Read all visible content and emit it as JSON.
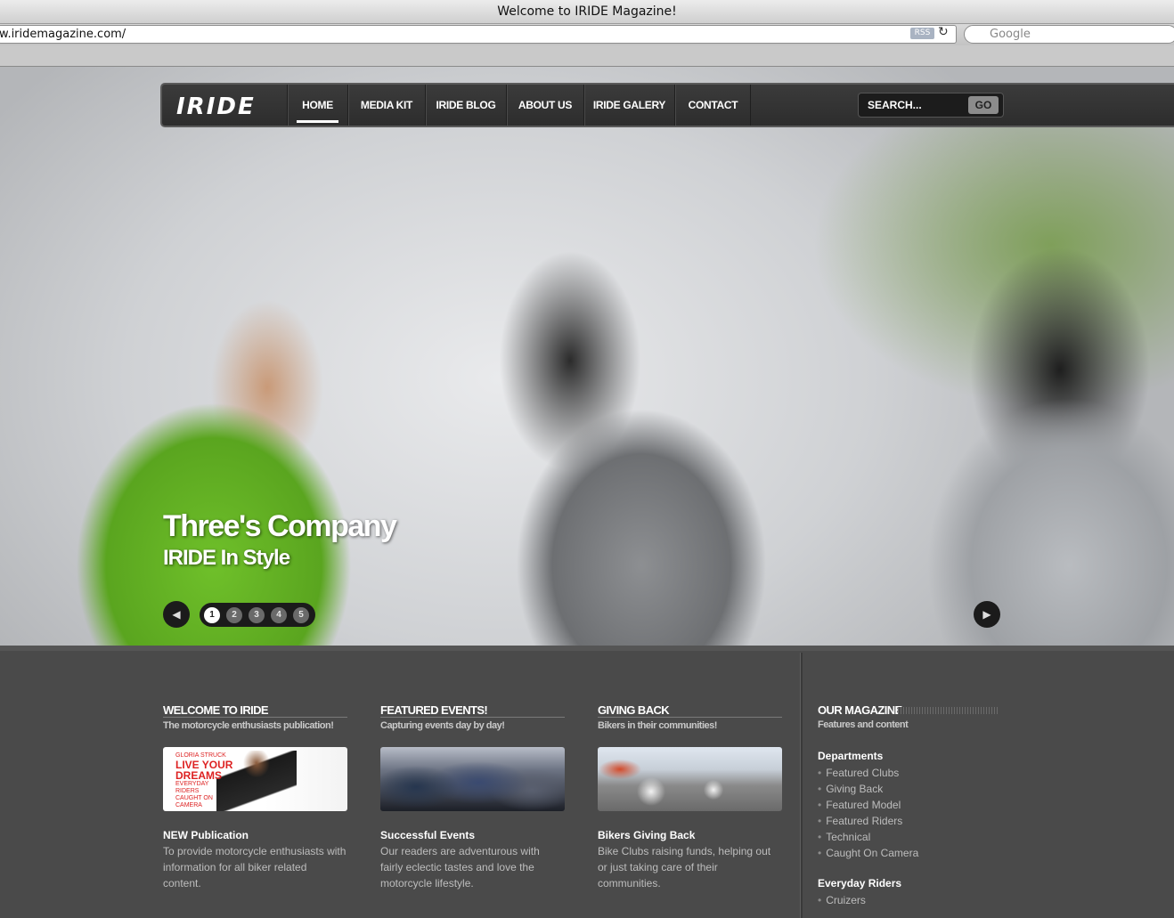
{
  "browser": {
    "title": "Welcome to IRIDE Magazine!",
    "url": "w.iridemagazine.com/",
    "rss": "RSS",
    "search_placeholder": "Google"
  },
  "nav": {
    "logo": "IRIDE",
    "items": [
      "HOME",
      "MEDIA KIT",
      "IRIDE BLOG",
      "ABOUT US",
      "IRIDE GALERY",
      "CONTACT"
    ],
    "active": "HOME",
    "search_placeholder": "SEARCH...",
    "go": "GO"
  },
  "slider": {
    "title": "Three's Company",
    "subtitle": "IRIDE In Style",
    "pages": [
      "1",
      "2",
      "3",
      "4",
      "5"
    ],
    "current": "1"
  },
  "columns": [
    {
      "heading": "WELCOME TO IRIDE",
      "sub": "The motorcycle enthusiasts publication!",
      "thumb_text": [
        "GLORIA STRUCK",
        "LIVE YOUR",
        "DREAMS",
        "EVERYDAY",
        "RIDERS",
        "CAUGHT ON",
        "CAMERA"
      ],
      "title": "NEW Publication",
      "body": "To provide motorcycle enthusiasts with information for all biker related content."
    },
    {
      "heading": "FEATURED EVENTS!",
      "sub": "Capturing events day by day!",
      "title": "Successful Events",
      "body": "Our readers are adventurous with fairly eclectic tastes and love the motorcycle lifestyle."
    },
    {
      "heading": "GIVING BACK",
      "sub": "Bikers in their communities!",
      "title": "Bikers Giving Back",
      "body": "Bike Clubs raising funds, helping out or just taking care of their communities."
    }
  ],
  "magazine": {
    "heading": "OUR MAGAZINE",
    "sub": "Features and content",
    "departments_title": "Departments",
    "departments": [
      "Featured Clubs",
      "Giving Back",
      "Featured Model",
      "Featured Riders",
      "Technical",
      "Caught On Camera"
    ],
    "everyday_title": "Everyday Riders",
    "everyday": [
      "Cruizers"
    ]
  }
}
